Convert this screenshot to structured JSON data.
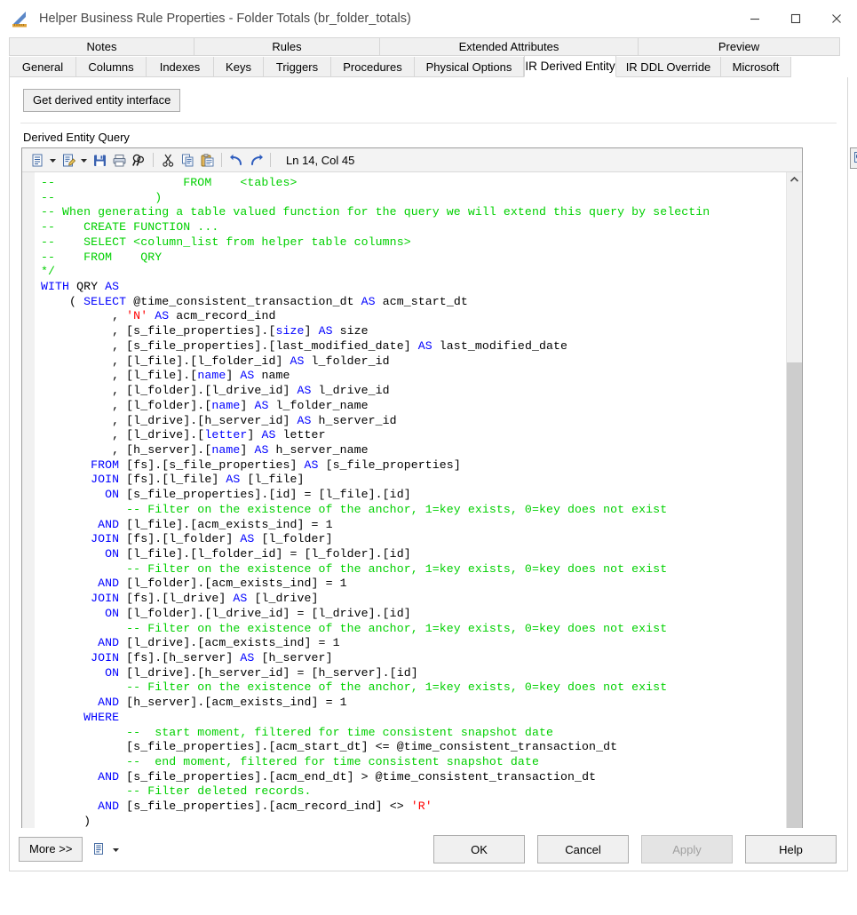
{
  "window": {
    "title": "Helper Business Rule Properties - Folder Totals (br_folder_totals)",
    "icon": "ruler-triangle-icon",
    "minimize": "—",
    "maximize": "☐",
    "close": "✕"
  },
  "tabs": {
    "top_row": [
      "Notes",
      "Rules",
      "Extended Attributes",
      "Preview"
    ],
    "bottom_row": [
      "General",
      "Columns",
      "Indexes",
      "Keys",
      "Triggers",
      "Procedures",
      "Physical Options",
      "IR Derived Entity",
      "IR DDL Override",
      "Microsoft"
    ],
    "active": "IR Derived Entity"
  },
  "page": {
    "get_interface_button": "Get derived entity interface",
    "section_label": "Derived Entity Query"
  },
  "editor": {
    "status": "Ln 14, Col 45",
    "toolbar_icons": [
      "new-document-icon",
      "new-document-dropdown-caret",
      "edit-document-icon",
      "edit-document-dropdown-caret",
      "save-icon",
      "print-icon",
      "find-icon",
      "cut-icon",
      "copy-icon",
      "paste-icon",
      "undo-icon",
      "redo-icon"
    ],
    "preview_button_icon": "magnifier-preview-icon",
    "scroll": {
      "v_up": "⌃",
      "v_down": "⌄",
      "h_left": "‹",
      "h_right": "›"
    },
    "code_lines": [
      {
        "t": "c",
        "s": "--                  FROM    <tables>"
      },
      {
        "t": "c",
        "s": "--              )"
      },
      {
        "t": "c",
        "s": "-- When generating a table valued function for the query we will extend this query by selectin"
      },
      {
        "t": "c",
        "s": "--    CREATE FUNCTION ..."
      },
      {
        "t": "c",
        "s": "--    SELECT <column_list from helper table columns>"
      },
      {
        "t": "c",
        "s": "--    FROM    QRY"
      },
      {
        "t": "c",
        "s": "*/"
      },
      {
        "t": "x",
        "s": "WITH QRY AS"
      },
      {
        "t": "x",
        "s": "    ( SELECT @time_consistent_transaction_dt AS acm_start_dt"
      },
      {
        "t": "x",
        "s": "          , 'N' AS acm_record_ind"
      },
      {
        "t": "x",
        "s": "          , [s_file_properties].[size] AS size"
      },
      {
        "t": "x",
        "s": "          , [s_file_properties].[last_modified_date] AS last_modified_date"
      },
      {
        "t": "x",
        "s": "          , [l_file].[l_folder_id] AS l_folder_id"
      },
      {
        "t": "x",
        "s": "          , [l_file].[name] AS name"
      },
      {
        "t": "x",
        "s": "          , [l_folder].[l_drive_id] AS l_drive_id"
      },
      {
        "t": "x",
        "s": "          , [l_folder].[name] AS l_folder_name"
      },
      {
        "t": "x",
        "s": "          , [l_drive].[h_server_id] AS h_server_id"
      },
      {
        "t": "x",
        "s": "          , [l_drive].[letter] AS letter"
      },
      {
        "t": "x",
        "s": "          , [h_server].[name] AS h_server_name"
      },
      {
        "t": "x",
        "s": "       FROM [fs].[s_file_properties] AS [s_file_properties]"
      },
      {
        "t": "x",
        "s": "       JOIN [fs].[l_file] AS [l_file]"
      },
      {
        "t": "x",
        "s": "         ON [s_file_properties].[id] = [l_file].[id]"
      },
      {
        "t": "c",
        "s": "            -- Filter on the existence of the anchor, 1=key exists, 0=key does not exist"
      },
      {
        "t": "x",
        "s": "        AND [l_file].[acm_exists_ind] = 1"
      },
      {
        "t": "x",
        "s": "       JOIN [fs].[l_folder] AS [l_folder]"
      },
      {
        "t": "x",
        "s": "         ON [l_file].[l_folder_id] = [l_folder].[id]"
      },
      {
        "t": "c",
        "s": "            -- Filter on the existence of the anchor, 1=key exists, 0=key does not exist"
      },
      {
        "t": "x",
        "s": "        AND [l_folder].[acm_exists_ind] = 1"
      },
      {
        "t": "x",
        "s": "       JOIN [fs].[l_drive] AS [l_drive]"
      },
      {
        "t": "x",
        "s": "         ON [l_folder].[l_drive_id] = [l_drive].[id]"
      },
      {
        "t": "c",
        "s": "            -- Filter on the existence of the anchor, 1=key exists, 0=key does not exist"
      },
      {
        "t": "x",
        "s": "        AND [l_drive].[acm_exists_ind] = 1"
      },
      {
        "t": "x",
        "s": "       JOIN [fs].[h_server] AS [h_server]"
      },
      {
        "t": "x",
        "s": "         ON [l_drive].[h_server_id] = [h_server].[id]"
      },
      {
        "t": "c",
        "s": "            -- Filter on the existence of the anchor, 1=key exists, 0=key does not exist"
      },
      {
        "t": "x",
        "s": "        AND [h_server].[acm_exists_ind] = 1"
      },
      {
        "t": "x",
        "s": "      WHERE"
      },
      {
        "t": "c",
        "s": "            --  start moment, filtered for time consistent snapshot date"
      },
      {
        "t": "x",
        "s": "            [s_file_properties].[acm_start_dt] <= @time_consistent_transaction_dt"
      },
      {
        "t": "c",
        "s": "            --  end moment, filtered for time consistent snapshot date"
      },
      {
        "t": "x",
        "s": "        AND [s_file_properties].[acm_end_dt] > @time_consistent_transaction_dt"
      },
      {
        "t": "c",
        "s": "            -- Filter deleted records."
      },
      {
        "t": "x",
        "s": "        AND [s_file_properties].[acm_record_ind] <> 'R'"
      },
      {
        "t": "x",
        "s": "      )"
      }
    ]
  },
  "footer": {
    "more": "More >>",
    "more_icon": "document-menu-icon",
    "more_caret": "dropdown-caret-icon",
    "ok": "OK",
    "cancel": "Cancel",
    "apply": "Apply",
    "help": "Help"
  },
  "colors": {
    "keyword": "#0000ff",
    "comment": "#00d000",
    "string": "#ff0000",
    "text": "#000000",
    "tab_bg": "#f0f0f0",
    "active_tab_bg": "#ffffff"
  }
}
